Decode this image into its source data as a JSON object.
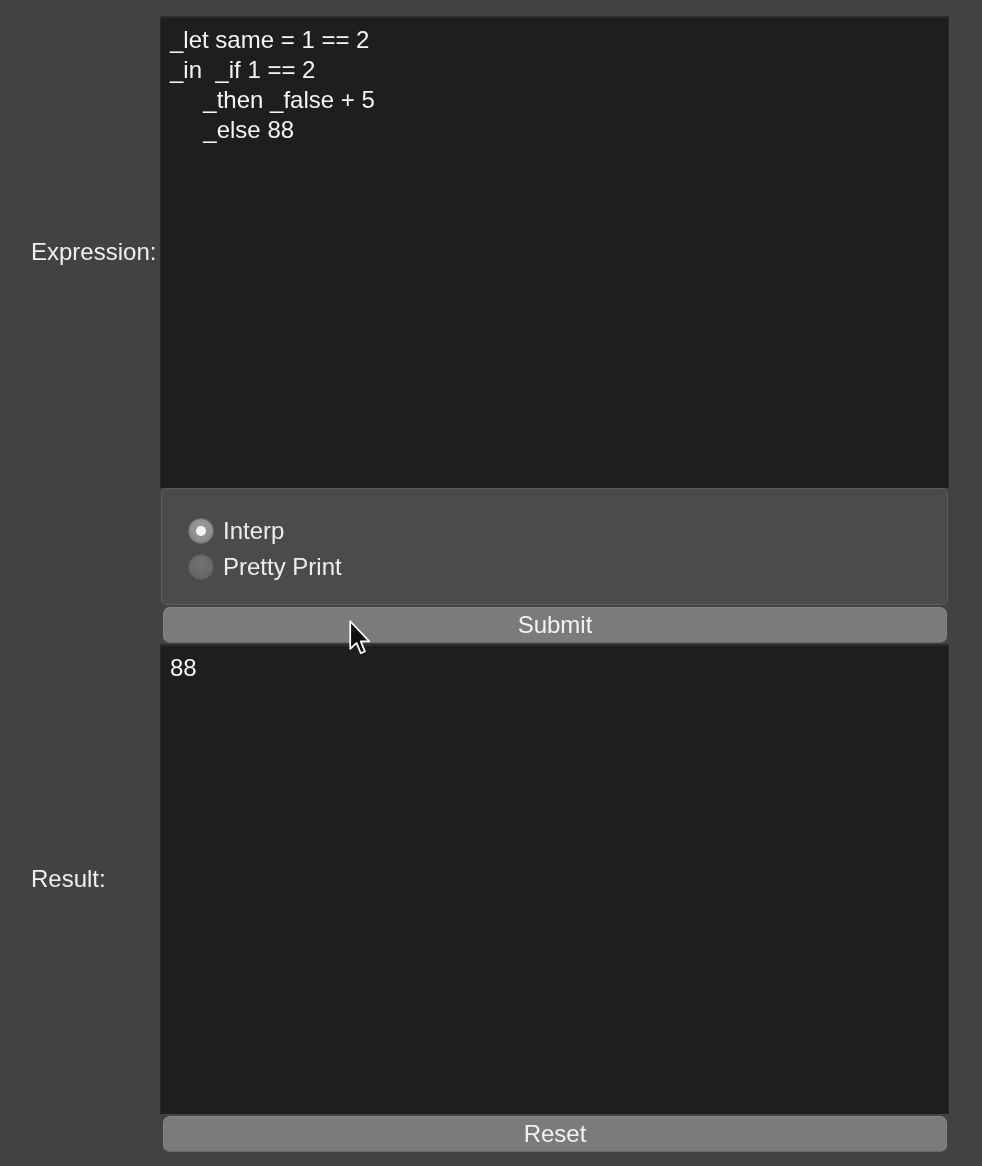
{
  "expression": {
    "label": "Expression:",
    "value": "_let same = 1 == 2\n_in  _if 1 == 2\n     _then _false + 5\n     _else 88"
  },
  "mode_options": [
    {
      "label": "Interp",
      "selected": true
    },
    {
      "label": "Pretty Print",
      "selected": false
    }
  ],
  "submit_button": "Submit",
  "result": {
    "label": "Result:",
    "value": "88"
  },
  "reset_button": "Reset"
}
